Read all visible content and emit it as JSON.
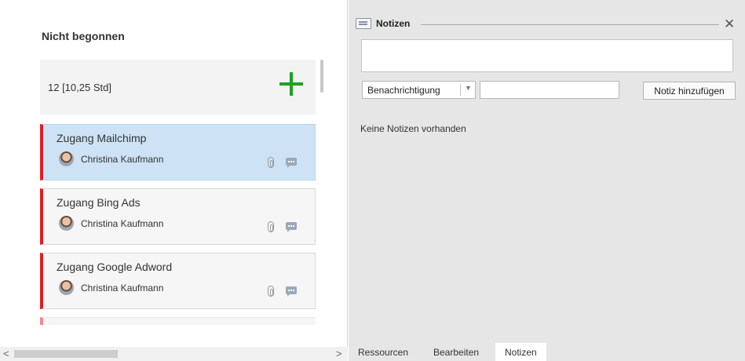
{
  "kanban": {
    "column_title": "Nicht begonnen",
    "summary": "12 [10,25 Std]",
    "cards": [
      {
        "title": "Zugang Mailchimp",
        "assignee": "Christina Kaufmann"
      },
      {
        "title": "Zugang Bing Ads",
        "assignee": "Christina Kaufmann"
      },
      {
        "title": "Zugang Google Adword",
        "assignee": "Christina Kaufmann"
      }
    ],
    "scroll": {
      "left_arrow": "<",
      "right_arrow": ">"
    }
  },
  "notes": {
    "title": "Notizen",
    "close": "✕",
    "type_value": "Benachrichtigung",
    "type_chevron": "▼",
    "add_button": "Notiz hinzufügen",
    "empty_message": "Keine Notizen vorhanden"
  },
  "tabs": [
    {
      "label": "Ressourcen"
    },
    {
      "label": "Bearbeiten"
    },
    {
      "label": "Notizen"
    }
  ],
  "colors": {
    "card_accent": "#e01e24",
    "add_icon": "#1aa221",
    "selected_card": "#cde3f5"
  }
}
